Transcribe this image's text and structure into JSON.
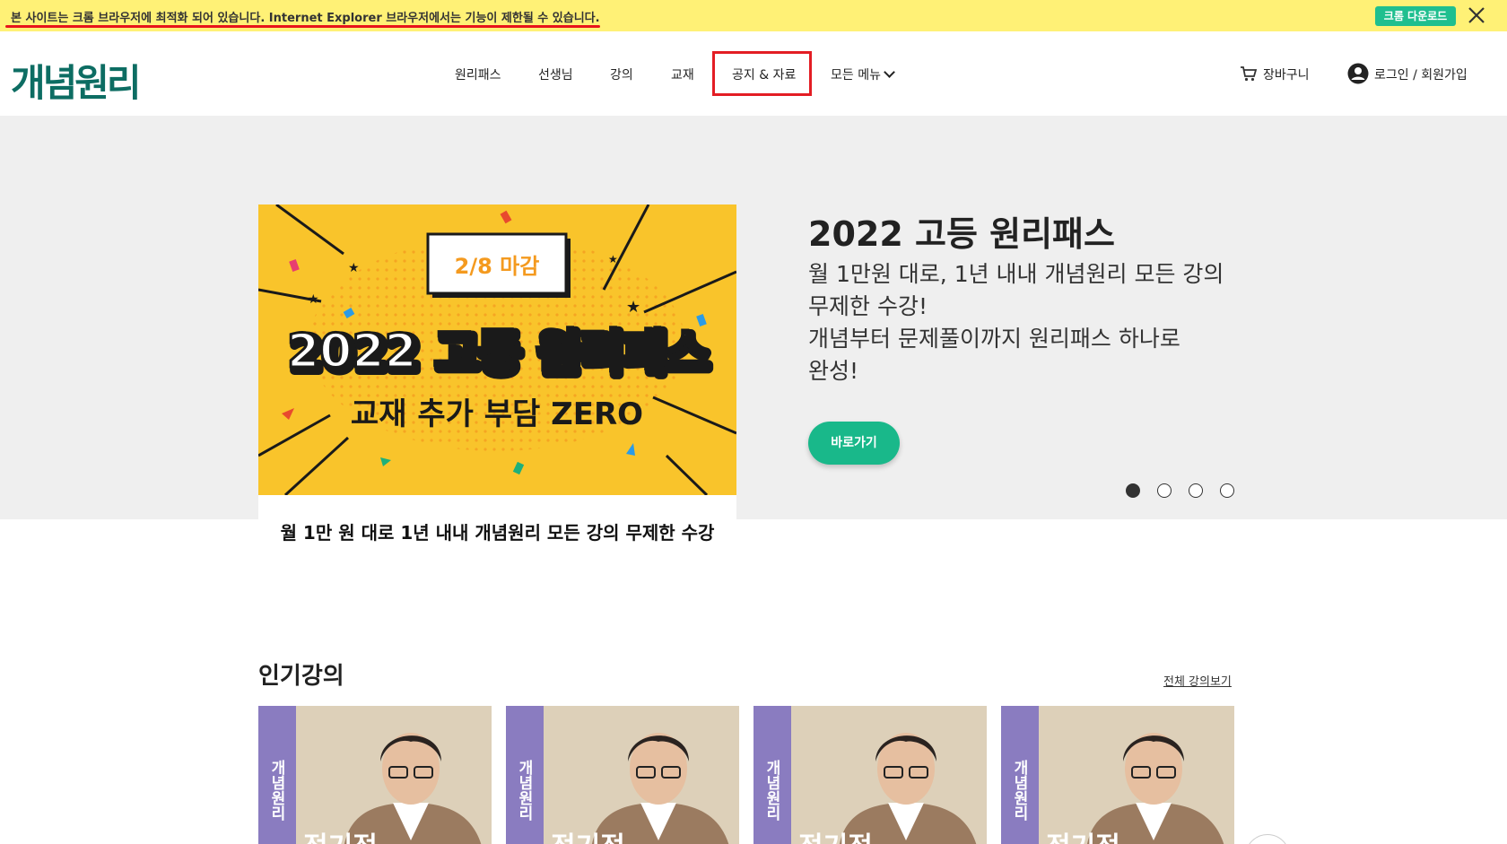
{
  "notice": {
    "text": "본 사이트는 크롬 브라우저에 최적화 되어 있습니다. Internet Explorer 브라우저에서는 기능이 제한될 수 있습니다.",
    "chrome_button": "크롬 다운로드"
  },
  "header": {
    "logo": "개념원리",
    "nav": [
      "원리패스",
      "선생님",
      "강의",
      "교재",
      "공지 & 자료",
      "모든 메뉴"
    ],
    "cart": "장바구니",
    "login": "로그인 / 회원가입"
  },
  "hero": {
    "banner": {
      "deadline": "2/8 마감",
      "headline": "2022 고등 원리패스",
      "subheadline": "교재 추가 부담 ZERO",
      "caption": "월 1만 원 대로 1년 내내  개념원리 모든 강의 무제한 수강"
    },
    "title": "2022 고등 원리패스",
    "description": "월 1만원 대로, 1년 내내 개념원리 모든 강의\n무제한 수강!\n 개념부터 문제풀이까지 원리패스 하나로\n완성!",
    "button": "바로가기",
    "slide_count": 4,
    "active_slide": 1
  },
  "popular": {
    "title": "인기강의",
    "view_all": "전체 강의보기",
    "cards": [
      {
        "strip": "개념원리",
        "name": "정기적"
      },
      {
        "strip": "개념원리",
        "name": "정기적"
      },
      {
        "strip": "개념원리",
        "name": "정기적"
      },
      {
        "strip": "개념원리",
        "name": "정기적"
      }
    ]
  },
  "colors": {
    "notice_bg": "#fff176",
    "brand_green": "#0d6d63",
    "button_green": "#19b88a",
    "highlight_red": "#e31d24",
    "banner_yellow": "#f9c42b",
    "card_purple": "#8a7cc0"
  }
}
